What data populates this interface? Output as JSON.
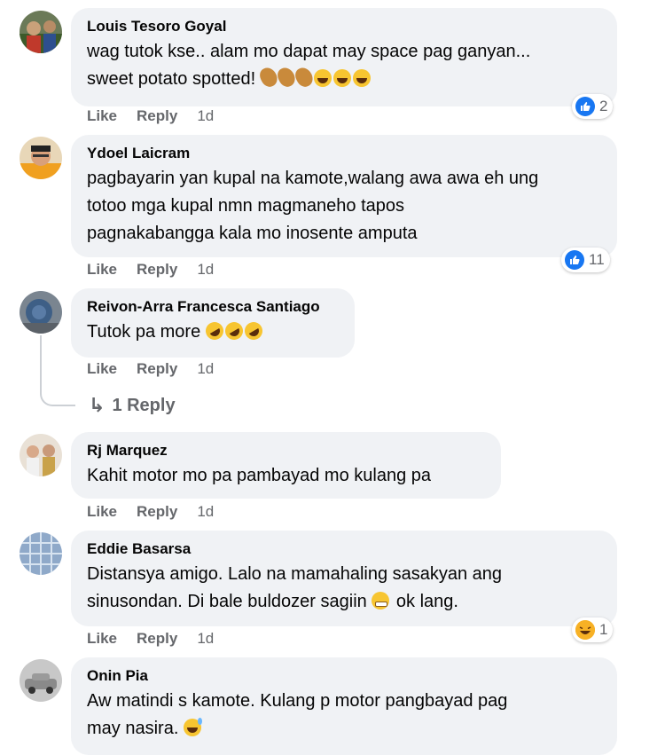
{
  "actions": {
    "like": "Like",
    "reply": "Reply"
  },
  "comments": [
    {
      "author": "Louis Tesoro Goyal",
      "text": "wag tutok kse.. alam mo dapat may space pag ganyan...\nsweet potato spotted!",
      "time": "1d",
      "reaction_count": "2",
      "reaction_type": "like",
      "emojis": [
        "potato",
        "potato",
        "potato",
        "laugh",
        "laugh",
        "laugh"
      ]
    },
    {
      "author": "Ydoel Laicram",
      "text": "pagbayarin yan kupal na kamote,walang awa awa eh ung\ntotoo mga kupal nmn magmaneho tapos\npagnakabangga kala mo inosente amputa",
      "time": "1d",
      "reaction_count": "11",
      "reaction_type": "like"
    },
    {
      "author": "Reivon-Arra Francesca Santiago",
      "text": "Tutok pa more",
      "time": "1d",
      "emojis": [
        "rofl",
        "rofl",
        "rofl"
      ],
      "replies_label": "1 Reply"
    },
    {
      "author": "Rj Marquez",
      "text": "Kahit motor mo pa pambayad mo kulang pa",
      "time": "1d"
    },
    {
      "author": "Eddie Basarsa",
      "text": "Distansya amigo. Lalo na mamahaling sasakyan ang\nsinusondan. Di bale buldozer sagiin",
      "text_after": "ok lang.",
      "time": "1d",
      "reaction_count": "1",
      "reaction_type": "haha"
    },
    {
      "author": "Onin Pia",
      "text": "Aw matindi s kamote. Kulang p motor pangbayad pag\nmay nasira."
    }
  ]
}
